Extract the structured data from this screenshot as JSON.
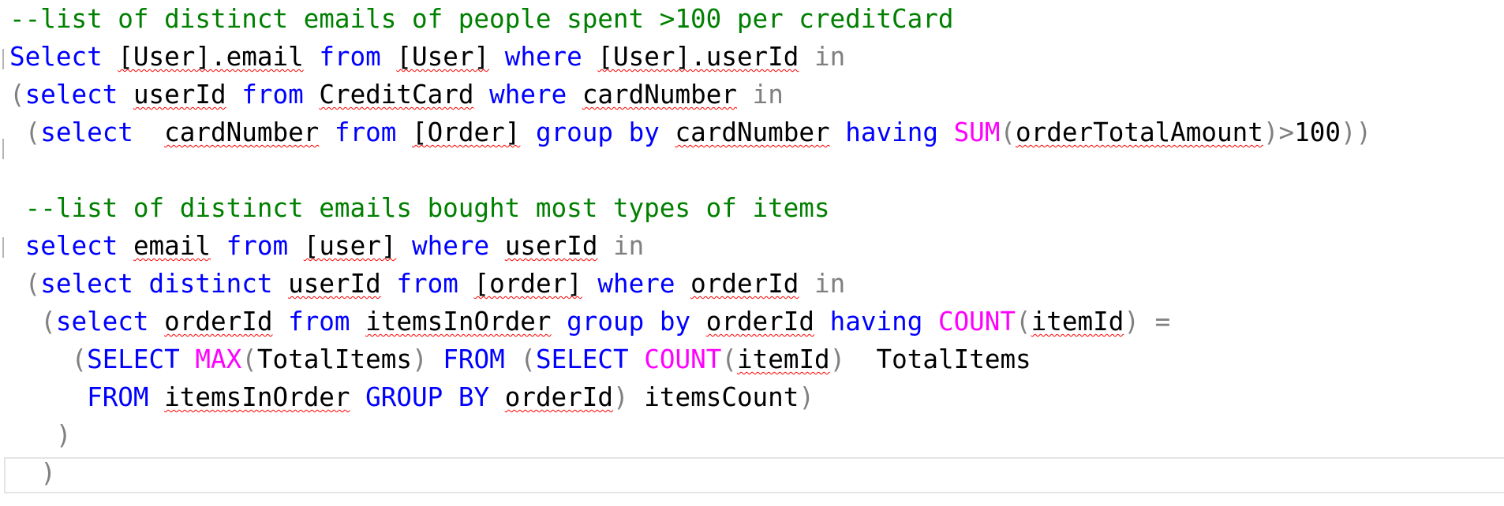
{
  "editor": {
    "language": "T-SQL",
    "colors": {
      "keyword": "#0000ff",
      "comment": "#008000",
      "function": "#ff00ff",
      "operator": "#808080",
      "text": "#000000",
      "squiggle": "#ff0000"
    },
    "lines": [
      {
        "tokens": [
          {
            "t": "--list of distinct emails of people spent >100 per creditCard",
            "c": "cm"
          }
        ]
      },
      {
        "tokens": [
          {
            "t": "Select",
            "c": "kw"
          },
          {
            "t": " ",
            "c": ""
          },
          {
            "t": "[User].email",
            "c": "sq"
          },
          {
            "t": " ",
            "c": ""
          },
          {
            "t": "from",
            "c": "kw"
          },
          {
            "t": " ",
            "c": ""
          },
          {
            "t": "[User]",
            "c": "sq"
          },
          {
            "t": " ",
            "c": ""
          },
          {
            "t": "where",
            "c": "kw"
          },
          {
            "t": " ",
            "c": ""
          },
          {
            "t": "[User].userId",
            "c": "sq"
          },
          {
            "t": " ",
            "c": ""
          },
          {
            "t": "in",
            "c": "op"
          }
        ]
      },
      {
        "tokens": [
          {
            "t": "(",
            "c": "op"
          },
          {
            "t": "select",
            "c": "kw"
          },
          {
            "t": " ",
            "c": ""
          },
          {
            "t": "userId",
            "c": "sq"
          },
          {
            "t": " ",
            "c": ""
          },
          {
            "t": "from",
            "c": "kw"
          },
          {
            "t": " ",
            "c": ""
          },
          {
            "t": "CreditCard",
            "c": "sq"
          },
          {
            "t": " ",
            "c": ""
          },
          {
            "t": "where",
            "c": "kw"
          },
          {
            "t": " ",
            "c": ""
          },
          {
            "t": "cardNumber",
            "c": "sq"
          },
          {
            "t": " ",
            "c": ""
          },
          {
            "t": "in",
            "c": "op"
          }
        ]
      },
      {
        "tokens": [
          {
            "t": " (",
            "c": "op"
          },
          {
            "t": "select",
            "c": "kw"
          },
          {
            "t": "  ",
            "c": ""
          },
          {
            "t": "cardNumber",
            "c": "sq"
          },
          {
            "t": " ",
            "c": ""
          },
          {
            "t": "from",
            "c": "kw"
          },
          {
            "t": " ",
            "c": ""
          },
          {
            "t": "[Order]",
            "c": "sq"
          },
          {
            "t": " ",
            "c": ""
          },
          {
            "t": "group by",
            "c": "kw"
          },
          {
            "t": " ",
            "c": ""
          },
          {
            "t": "cardNumber",
            "c": "sq"
          },
          {
            "t": " ",
            "c": ""
          },
          {
            "t": "having",
            "c": "kw"
          },
          {
            "t": " ",
            "c": ""
          },
          {
            "t": "SUM",
            "c": "fn"
          },
          {
            "t": "(",
            "c": "op"
          },
          {
            "t": "orderTotalAmount",
            "c": "sq"
          },
          {
            "t": ")>",
            "c": "op"
          },
          {
            "t": "100",
            "c": ""
          },
          {
            "t": "))",
            "c": "op"
          }
        ]
      },
      {
        "tokens": []
      },
      {
        "tokens": [
          {
            "t": " --list of distinct emails bought most types of items",
            "c": "cm"
          }
        ]
      },
      {
        "tokens": [
          {
            "t": " ",
            "c": ""
          },
          {
            "t": "select",
            "c": "kw"
          },
          {
            "t": " ",
            "c": ""
          },
          {
            "t": "email",
            "c": "sq"
          },
          {
            "t": " ",
            "c": ""
          },
          {
            "t": "from",
            "c": "kw"
          },
          {
            "t": " ",
            "c": ""
          },
          {
            "t": "[user]",
            "c": "sq"
          },
          {
            "t": " ",
            "c": ""
          },
          {
            "t": "where",
            "c": "kw"
          },
          {
            "t": " ",
            "c": ""
          },
          {
            "t": "userId",
            "c": "sq"
          },
          {
            "t": " ",
            "c": ""
          },
          {
            "t": "in",
            "c": "op"
          }
        ]
      },
      {
        "tokens": [
          {
            "t": " (",
            "c": "op"
          },
          {
            "t": "select",
            "c": "kw"
          },
          {
            "t": " ",
            "c": ""
          },
          {
            "t": "distinct",
            "c": "kw"
          },
          {
            "t": " ",
            "c": ""
          },
          {
            "t": "userId",
            "c": "sq"
          },
          {
            "t": " ",
            "c": ""
          },
          {
            "t": "from",
            "c": "kw"
          },
          {
            "t": " ",
            "c": ""
          },
          {
            "t": "[order]",
            "c": "sq"
          },
          {
            "t": " ",
            "c": ""
          },
          {
            "t": "where",
            "c": "kw"
          },
          {
            "t": " ",
            "c": ""
          },
          {
            "t": "orderId",
            "c": "sq"
          },
          {
            "t": " ",
            "c": ""
          },
          {
            "t": "in",
            "c": "op"
          }
        ]
      },
      {
        "tokens": [
          {
            "t": "  (",
            "c": "op"
          },
          {
            "t": "select",
            "c": "kw"
          },
          {
            "t": " ",
            "c": ""
          },
          {
            "t": "orderId",
            "c": "sq"
          },
          {
            "t": " ",
            "c": ""
          },
          {
            "t": "from",
            "c": "kw"
          },
          {
            "t": " ",
            "c": ""
          },
          {
            "t": "itemsInOrder",
            "c": "sq"
          },
          {
            "t": " ",
            "c": ""
          },
          {
            "t": "group by",
            "c": "kw"
          },
          {
            "t": " ",
            "c": ""
          },
          {
            "t": "orderId",
            "c": "sq"
          },
          {
            "t": " ",
            "c": ""
          },
          {
            "t": "having",
            "c": "kw"
          },
          {
            "t": " ",
            "c": ""
          },
          {
            "t": "COUNT",
            "c": "fn"
          },
          {
            "t": "(",
            "c": "op"
          },
          {
            "t": "itemId",
            "c": "sq"
          },
          {
            "t": ") =",
            "c": "op"
          }
        ]
      },
      {
        "tokens": [
          {
            "t": "    (",
            "c": "op"
          },
          {
            "t": "SELECT",
            "c": "kw"
          },
          {
            "t": " ",
            "c": ""
          },
          {
            "t": "MAX",
            "c": "fn"
          },
          {
            "t": "(",
            "c": "op"
          },
          {
            "t": "TotalItems",
            "c": ""
          },
          {
            "t": ")",
            "c": "op"
          },
          {
            "t": " ",
            "c": ""
          },
          {
            "t": "FROM",
            "c": "kw"
          },
          {
            "t": " ",
            "c": ""
          },
          {
            "t": "(",
            "c": "op"
          },
          {
            "t": "SELECT",
            "c": "kw"
          },
          {
            "t": " ",
            "c": ""
          },
          {
            "t": "COUNT",
            "c": "fn"
          },
          {
            "t": "(",
            "c": "op"
          },
          {
            "t": "itemId",
            "c": "sq"
          },
          {
            "t": ")",
            "c": "op"
          },
          {
            "t": "  ",
            "c": ""
          },
          {
            "t": "TotalItems",
            "c": ""
          }
        ]
      },
      {
        "tokens": [
          {
            "t": "     ",
            "c": ""
          },
          {
            "t": "FROM",
            "c": "kw"
          },
          {
            "t": " ",
            "c": ""
          },
          {
            "t": "itemsInOrder",
            "c": "sq"
          },
          {
            "t": " ",
            "c": ""
          },
          {
            "t": "GROUP BY",
            "c": "kw"
          },
          {
            "t": " ",
            "c": ""
          },
          {
            "t": "orderId",
            "c": "sq"
          },
          {
            "t": ")",
            "c": "op"
          },
          {
            "t": " ",
            "c": ""
          },
          {
            "t": "itemsCount",
            "c": ""
          },
          {
            "t": ")",
            "c": "op"
          }
        ]
      },
      {
        "tokens": [
          {
            "t": "   )",
            "c": "op"
          }
        ]
      },
      {
        "tokens": [
          {
            "t": "  )",
            "c": "op"
          }
        ]
      }
    ]
  }
}
